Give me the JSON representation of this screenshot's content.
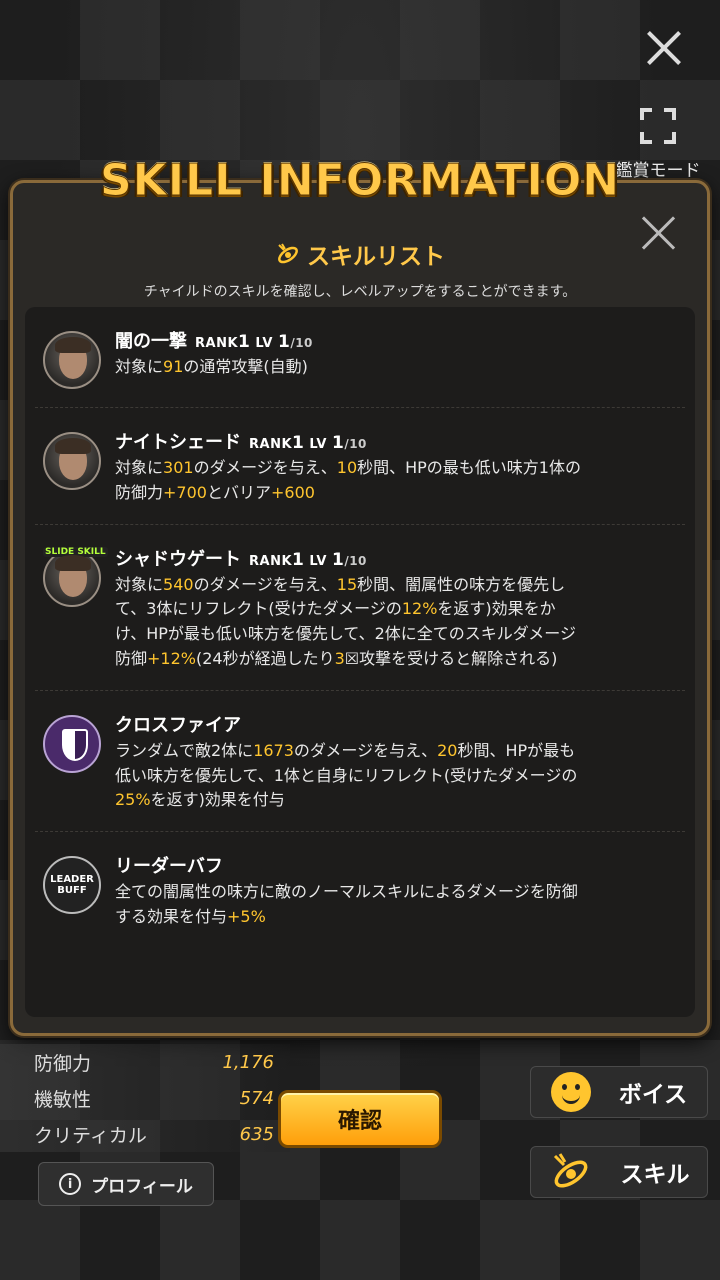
{
  "top": {
    "view_mode_label": "鑑賞モード"
  },
  "dialog": {
    "title": "SKILL INFORMATION",
    "list_title": "スキルリスト",
    "list_subtitle": "チャイルドのスキルを確認し、レベルアップをすることができます。",
    "skills": [
      {
        "name": "闇の一撃",
        "rank": "RANK",
        "rank_num": "1",
        "lv": "LV",
        "lv_num": "1",
        "lv_max": "/10",
        "desc": [
          {
            "t": "対象に"
          },
          {
            "t": "91",
            "h": true
          },
          {
            "t": "の通常攻撃(自動)"
          }
        ]
      },
      {
        "name": "ナイトシェード",
        "rank": "RANK",
        "rank_num": "1",
        "lv": "LV",
        "lv_num": "1",
        "lv_max": "/10",
        "desc": [
          {
            "t": "対象に"
          },
          {
            "t": "301",
            "h": true
          },
          {
            "t": "のダメージを与え、"
          },
          {
            "t": "10",
            "h": true
          },
          {
            "t": "秒間、HPの最も低い味方1体の防御力"
          },
          {
            "t": "+700",
            "h": true
          },
          {
            "t": "とバリア"
          },
          {
            "t": "+600",
            "h": true
          }
        ]
      },
      {
        "badge": "SLIDE SKILL",
        "name": "シャドウゲート",
        "rank": "RANK",
        "rank_num": "1",
        "lv": "LV",
        "lv_num": "1",
        "lv_max": "/10",
        "desc": [
          {
            "t": "対象に"
          },
          {
            "t": "540",
            "h": true
          },
          {
            "t": "のダメージを与え、"
          },
          {
            "t": "15",
            "h": true
          },
          {
            "t": "秒間、闇属性の味方を優先して、3体にリフレクト(受けたダメージの"
          },
          {
            "t": "12%",
            "h": true
          },
          {
            "t": "を返す)効果をかけ、HPが最も低い味方を優先して、2体に全てのスキルダメージ防御"
          },
          {
            "t": "+12%",
            "h": true
          },
          {
            "t": "(24秒が経過したり"
          },
          {
            "t": "3",
            "h": true
          },
          {
            "t": "☒攻撃を受けると解除される)"
          }
        ]
      },
      {
        "name": "クロスファイア",
        "desc": [
          {
            "t": "ランダムで敵2体に"
          },
          {
            "t": "1673",
            "h": true
          },
          {
            "t": "のダメージを与え、"
          },
          {
            "t": "20",
            "h": true
          },
          {
            "t": "秒間、HPが最も低い味方を優先して、1体と自身にリフレクト(受けたダメージの"
          },
          {
            "t": "25%",
            "h": true
          },
          {
            "t": "を返す)効果を付与"
          }
        ]
      },
      {
        "icon_label": "LEADER BUFF",
        "name": "リーダーバフ",
        "desc": [
          {
            "t": "全ての闇属性の味方に敵のノーマルスキルによるダメージを防御する効果を付与"
          },
          {
            "t": "+5%",
            "h": true
          }
        ]
      }
    ]
  },
  "stats": [
    {
      "label": "防御力",
      "value": "1,176"
    },
    {
      "label": "機敏性",
      "value": "574"
    },
    {
      "label": "クリティカル",
      "value": "635"
    }
  ],
  "buttons": {
    "profile": "プロフィール",
    "confirm": "確認",
    "voice": "ボイス",
    "skill": "スキル"
  },
  "colors": {
    "accent": "#ffc52e",
    "panel_border": "#8a6a3a"
  }
}
